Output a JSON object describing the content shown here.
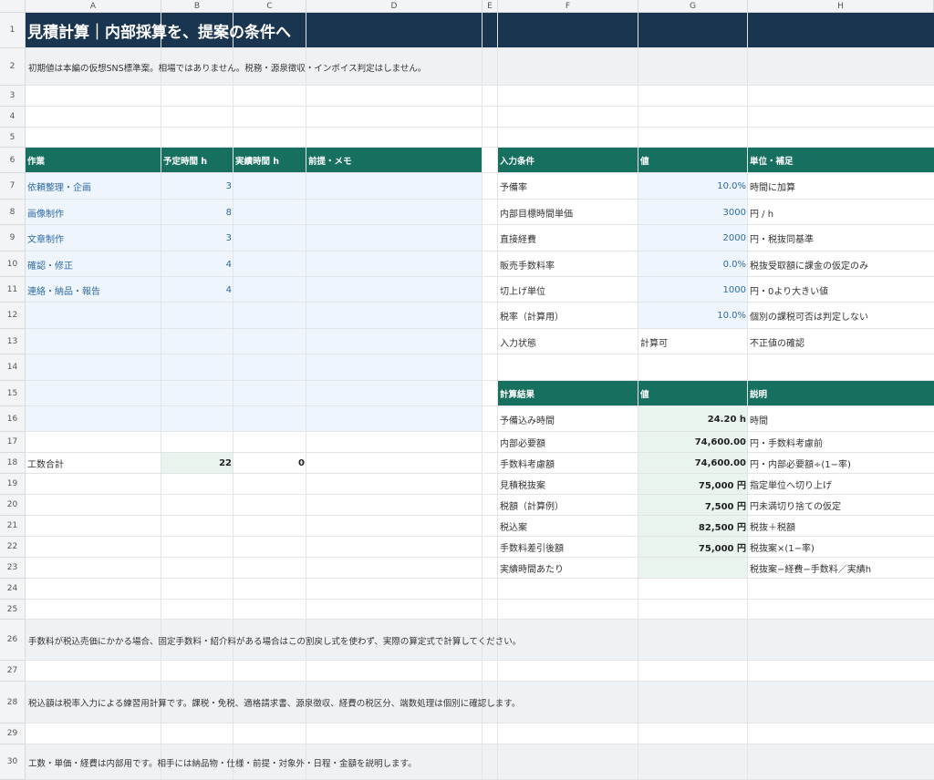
{
  "columns": [
    "A",
    "B",
    "C",
    "D",
    "E",
    "F",
    "G",
    "H"
  ],
  "rows": [
    "1",
    "2",
    "3",
    "4",
    "5",
    "6",
    "7",
    "8",
    "9",
    "10",
    "11",
    "12",
    "13",
    "14",
    "15",
    "16",
    "17",
    "18",
    "19",
    "20",
    "21",
    "22",
    "23",
    "24",
    "25",
    "26",
    "27",
    "28",
    "29",
    "30"
  ],
  "title": "見積計算｜内部採算を、提案の条件へ",
  "subtitle": "初期値は本編の仮想SNS標準案。相場ではありません。税務・源泉徴収・インボイス判定はしません。",
  "tasks": {
    "headers": [
      "作業",
      "予定時間 h",
      "実績時間 h",
      "前提・メモ"
    ],
    "rows": [
      {
        "name": "依頼整理・企画",
        "planned": "3"
      },
      {
        "name": "画像制作",
        "planned": "8"
      },
      {
        "name": "文章制作",
        "planned": "3"
      },
      {
        "name": "確認・修正",
        "planned": "4"
      },
      {
        "name": "連絡・納品・報告",
        "planned": "4"
      }
    ],
    "total_label": "工数合計",
    "total_planned": "22",
    "total_actual": "0"
  },
  "inputs": {
    "headers": [
      "入力条件",
      "値",
      "単位・補足"
    ],
    "rows": [
      {
        "label": "予備率",
        "value": "10.0%",
        "note": "時間に加算"
      },
      {
        "label": "内部目標時間単価",
        "value": "3000",
        "note": "円 / h"
      },
      {
        "label": "直接経費",
        "value": "2000",
        "note": "円・税抜同基準"
      },
      {
        "label": "販売手数料率",
        "value": "0.0%",
        "note": "税抜受取額に課金の仮定のみ"
      },
      {
        "label": "切上げ単位",
        "value": "1000",
        "note": "円・0より大きい値"
      },
      {
        "label": "税率（計算用）",
        "value": "10.0%",
        "note": "個別の課税可否は判定しない"
      }
    ],
    "status_label": "入力状態",
    "status_value": "計算可",
    "status_note": "不正値の確認"
  },
  "results": {
    "headers": [
      "計算結果",
      "値",
      "説明"
    ],
    "rows": [
      {
        "label": "予備込み時間",
        "value": "24.20 h",
        "note": "時間"
      },
      {
        "label": "内部必要額",
        "value": "74,600.00",
        "note": "円・手数料考慮前"
      },
      {
        "label": "手数料考慮額",
        "value": "74,600.00",
        "note": "円・内部必要額÷(1−率)"
      },
      {
        "label": "見積税抜案",
        "value": "75,000 円",
        "note": "指定単位へ切り上げ"
      },
      {
        "label": "税額（計算例）",
        "value": "7,500 円",
        "note": "円未満切り捨ての仮定"
      },
      {
        "label": "税込案",
        "value": "82,500 円",
        "note": "税抜＋税額"
      },
      {
        "label": "手数料差引後額",
        "value": "75,000 円",
        "note": "税抜案×(1−率)"
      },
      {
        "label": "実績時間あたり",
        "value": "",
        "note": "税抜案−経費−手数料／実績h"
      }
    ]
  },
  "notes": {
    "row26": "手数料が税込売価にかかる場合、固定手数料・紹介料がある場合はこの割戻し式を使わず、実際の算定式で計算してください。",
    "row28": "税込額は税率入力による練習用計算です。課税・免税、適格請求書、源泉徴収、経費の税区分、端数処理は個別に確認します。",
    "row30": "工数・単価・経費は内部用です。相手には納品物・仕様・前提・対象外・日程・金額を説明します。"
  },
  "colors": {
    "title_bg": "#1a3550",
    "header_bg": "#17705f",
    "input_bg": "#eef5fc",
    "result_bg": "#e9f4ee",
    "note_bg": "#eff2f4",
    "value_blue": "#2e6aa6"
  }
}
